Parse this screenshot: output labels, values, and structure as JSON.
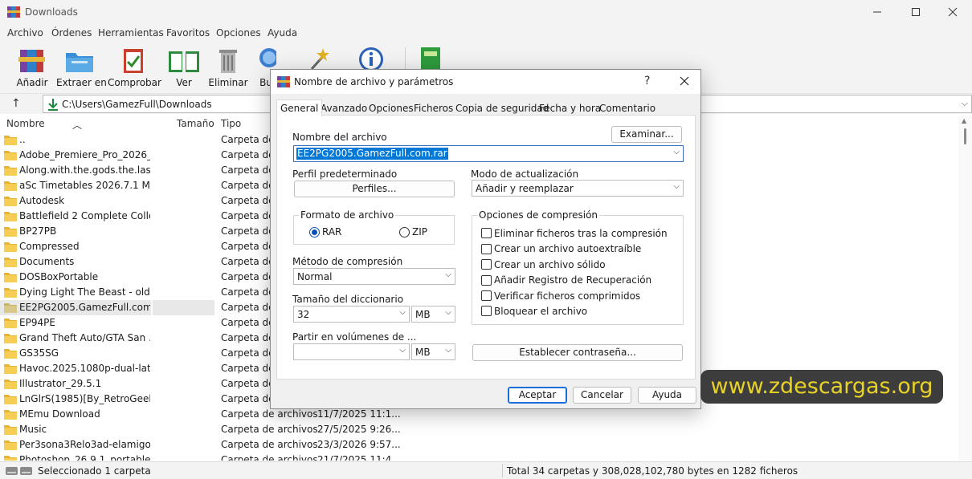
{
  "window": {
    "title": "Downloads"
  },
  "menu": [
    "Archivo",
    "Órdenes",
    "Herramientas",
    "Favoritos",
    "Opciones",
    "Ayuda"
  ],
  "toolbar": {
    "add": "Añadir",
    "extract": "Extraer en",
    "test": "Comprobar",
    "view": "Ver",
    "delete": "Eliminar",
    "find": "Bu"
  },
  "address": {
    "path": "C:\\Users\\GamezFull\\Downloads"
  },
  "columns": {
    "name": "Nombre",
    "size": "Tamaño",
    "type": "Tipo"
  },
  "files": [
    {
      "name": "..",
      "type": "Carpeta de",
      "date": ""
    },
    {
      "name": "Adobe_Premiere_Pro_2026_v...",
      "type": "Carpeta de",
      "date": ""
    },
    {
      "name": "Along.with.the.gods.the.last....",
      "type": "Carpeta de",
      "date": ""
    },
    {
      "name": "aSc Timetables 2026.7.1 Mult...",
      "type": "Carpeta de",
      "date": ""
    },
    {
      "name": "Autodesk",
      "type": "Carpeta de",
      "date": ""
    },
    {
      "name": "Battlefield 2 Complete Colle...",
      "type": "Carpeta de",
      "date": ""
    },
    {
      "name": "BP27PB",
      "type": "Carpeta de",
      "date": ""
    },
    {
      "name": "Compressed",
      "type": "Carpeta de",
      "date": ""
    },
    {
      "name": "Documents",
      "type": "Carpeta de",
      "date": ""
    },
    {
      "name": "DOSBoxPortable",
      "type": "Carpeta de",
      "date": ""
    },
    {
      "name": "Dying Light The Beast - old ...",
      "type": "Carpeta de",
      "date": ""
    },
    {
      "name": "EE2PG2005.GamezFull.com",
      "type": "Carpeta de",
      "date": ""
    },
    {
      "name": "EP94PE",
      "type": "Carpeta de",
      "date": ""
    },
    {
      "name": "Grand Theft Auto/GTA San ...",
      "type": "Carpeta de",
      "date": ""
    },
    {
      "name": "GS35SG",
      "type": "Carpeta de",
      "date": ""
    },
    {
      "name": "Havoc.2025.1080p-dual-lat-c...",
      "type": "Carpeta de",
      "date": ""
    },
    {
      "name": "Illustrator_29.5.1",
      "type": "Carpeta de",
      "date": ""
    },
    {
      "name": "LnGlrS(1985)[By_RetroGeeks...",
      "type": "Carpeta de",
      "date": ""
    },
    {
      "name": "MEmu Download",
      "type": "Carpeta de archivos",
      "date": "11/7/2025 11:1..."
    },
    {
      "name": "Music",
      "type": "Carpeta de archivos",
      "date": "27/5/2025 9:26..."
    },
    {
      "name": "Per3sona3Relo3ad-elamigos",
      "type": "Carpeta de archivos",
      "date": "23/3/2026 9:57..."
    },
    {
      "name": "Photoshop_26.9.1_portable",
      "type": "Carpeta de archivos",
      "date": "21/7/2025 11:4..."
    }
  ],
  "status": {
    "left": "Seleccionado 1 carpeta",
    "right": "Total 34 carpetas y 308,028,102,780 bytes en 1282 ficheros"
  },
  "dialog": {
    "title": "Nombre de archivo y parámetros",
    "help": "?",
    "tabs": [
      "General",
      "Avanzado",
      "Opciones",
      "Ficheros",
      "Copia de seguridad",
      "Fecha y hora",
      "Comentario"
    ],
    "archive_name_label": "Nombre del archivo",
    "browse": "Examinar...",
    "archive_name": "EE2PG2005.GamezFull.com.rar",
    "profile_label": "Perfil predeterminado",
    "profiles_button": "Perfiles...",
    "update_mode_label": "Modo de actualización",
    "update_mode": "Añadir y reemplazar",
    "format_label": "Formato de archivo",
    "format_rar": "RAR",
    "format_zip": "ZIP",
    "method_label": "Método de compresión",
    "method": "Normal",
    "dict_label": "Tamaño del diccionario",
    "dict_value": "32",
    "dict_unit": "MB",
    "split_label": "Partir en volúmenes de ...",
    "split_value": "",
    "split_unit": "MB",
    "options_label": "Opciones de compresión",
    "options": [
      "Eliminar ficheros tras la compresión",
      "Crear un archivo autoextraíble",
      "Crear un archivo sólido",
      "Añadir Registro de Recuperación",
      "Verificar ficheros comprimidos",
      "Bloquear el archivo"
    ],
    "password_button": "Establecer contraseña...",
    "ok": "Aceptar",
    "cancel": "Cancelar",
    "helpbtn": "Ayuda"
  },
  "watermark": "www.zdescargas.org"
}
